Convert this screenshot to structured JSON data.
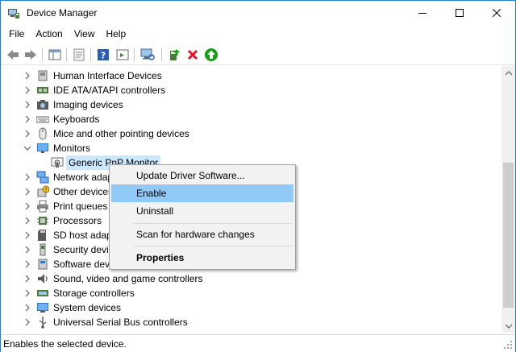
{
  "window": {
    "title": "Device Manager",
    "icons": {
      "app": "device-manager-icon",
      "minimize": "minimize-icon",
      "maximize": "maximize-icon",
      "close": "close-icon"
    }
  },
  "menu": [
    "File",
    "Action",
    "View",
    "Help"
  ],
  "toolbar": {
    "buttons": [
      "back-arrow-icon",
      "forward-arrow-icon",
      "show-hide-tree-icon",
      "properties-icon",
      "help-icon",
      "run-action-icon",
      "scan-hardware-icon",
      "update-driver-icon",
      "uninstall-icon",
      "enable-device-icon"
    ]
  },
  "tree": {
    "items": [
      {
        "label": "Human Interface Devices",
        "icon": "hid-icon",
        "state": "collapsed"
      },
      {
        "label": "IDE ATA/ATAPI controllers",
        "icon": "ide-controller-icon",
        "state": "collapsed"
      },
      {
        "label": "Imaging devices",
        "icon": "camera-icon",
        "state": "collapsed"
      },
      {
        "label": "Keyboards",
        "icon": "keyboard-icon",
        "state": "collapsed"
      },
      {
        "label": "Mice and other pointing devices",
        "icon": "mouse-icon",
        "state": "collapsed"
      },
      {
        "label": "Monitors",
        "icon": "monitor-icon",
        "state": "expanded"
      },
      {
        "label": "Generic PnP Monitor",
        "icon": "disabled-monitor-icon",
        "state": "child-selected"
      },
      {
        "label": "Network adapters",
        "icon": "network-icon",
        "state": "collapsed"
      },
      {
        "label": "Other devices",
        "icon": "other-devices-icon",
        "state": "collapsed"
      },
      {
        "label": "Print queues",
        "icon": "printer-icon",
        "state": "collapsed"
      },
      {
        "label": "Processors",
        "icon": "processor-icon",
        "state": "collapsed"
      },
      {
        "label": "SD host adapters",
        "icon": "sd-card-icon",
        "state": "collapsed"
      },
      {
        "label": "Security devices",
        "icon": "security-device-icon",
        "state": "collapsed"
      },
      {
        "label": "Software devices",
        "icon": "software-device-icon",
        "state": "collapsed"
      },
      {
        "label": "Sound, video and game controllers",
        "icon": "speaker-icon",
        "state": "collapsed"
      },
      {
        "label": "Storage controllers",
        "icon": "storage-icon",
        "state": "collapsed"
      },
      {
        "label": "System devices",
        "icon": "system-device-icon",
        "state": "collapsed"
      },
      {
        "label": "Universal Serial Bus controllers",
        "icon": "usb-icon",
        "state": "collapsed"
      }
    ]
  },
  "context_menu": {
    "items": [
      {
        "label": "Update Driver Software...",
        "highlighted": false,
        "bold": false
      },
      {
        "label": "Enable",
        "highlighted": true,
        "bold": false
      },
      {
        "label": "Uninstall",
        "highlighted": false,
        "bold": false
      },
      {
        "label": "Scan for hardware changes",
        "highlighted": false,
        "bold": false
      },
      {
        "label": "Properties",
        "highlighted": false,
        "bold": true
      }
    ]
  },
  "status": {
    "text": "Enables the selected device."
  },
  "colors": {
    "accent": "#1883d7",
    "selection": "#cce8ff",
    "menu_highlight": "#91c9f7",
    "uninstall_red": "#e81123",
    "enable_green": "#10a010"
  }
}
